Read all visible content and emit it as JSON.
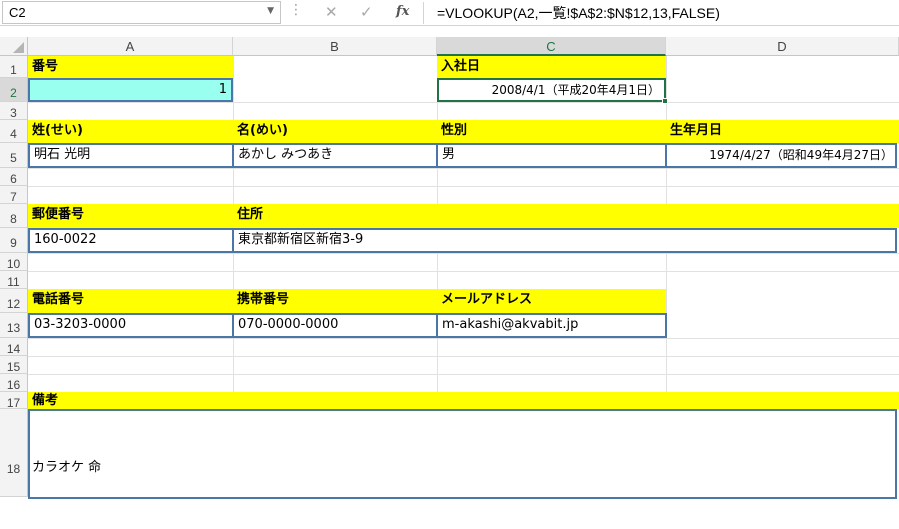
{
  "name_box": "C2",
  "formula": "=VLOOKUP(A2,一覧!$A$2:$N$12,13,FALSE)",
  "fx_label": "fx",
  "columns": [
    "A",
    "B",
    "C",
    "D"
  ],
  "rows": [
    "1",
    "2",
    "3",
    "4",
    "5",
    "6",
    "7",
    "8",
    "9",
    "10",
    "11",
    "12",
    "13",
    "14",
    "15",
    "16",
    "17",
    "18"
  ],
  "labels": {
    "number": "番号",
    "hire_date": "入社日",
    "last_name": "姓(せい)",
    "first_name": "名(めい)",
    "gender": "性別",
    "birthdate": "生年月日",
    "postal": "郵便番号",
    "address": "住所",
    "phone": "電話番号",
    "mobile": "携帯番号",
    "email": "メールアドレス",
    "notes": "備考"
  },
  "values": {
    "number": "1",
    "hire_date": "2008/4/1（平成20年4月1日）",
    "last_name": "明石 光明",
    "first_name": "あかし みつあき",
    "gender": "男",
    "birthdate": "1974/4/27（昭和49年4月27日）",
    "postal": "160-0022",
    "address": "東京都新宿区新宿3-9",
    "phone": "03-3203-0000",
    "mobile": "070-0000-0000",
    "email": "m-akashi@akvabit.jp",
    "notes": "カラオケ 命"
  },
  "colors": {
    "highlight": "#ffff00",
    "input_cell": "#99ffee",
    "selected_green": "#217346",
    "border_blue": "#4a76a8"
  }
}
